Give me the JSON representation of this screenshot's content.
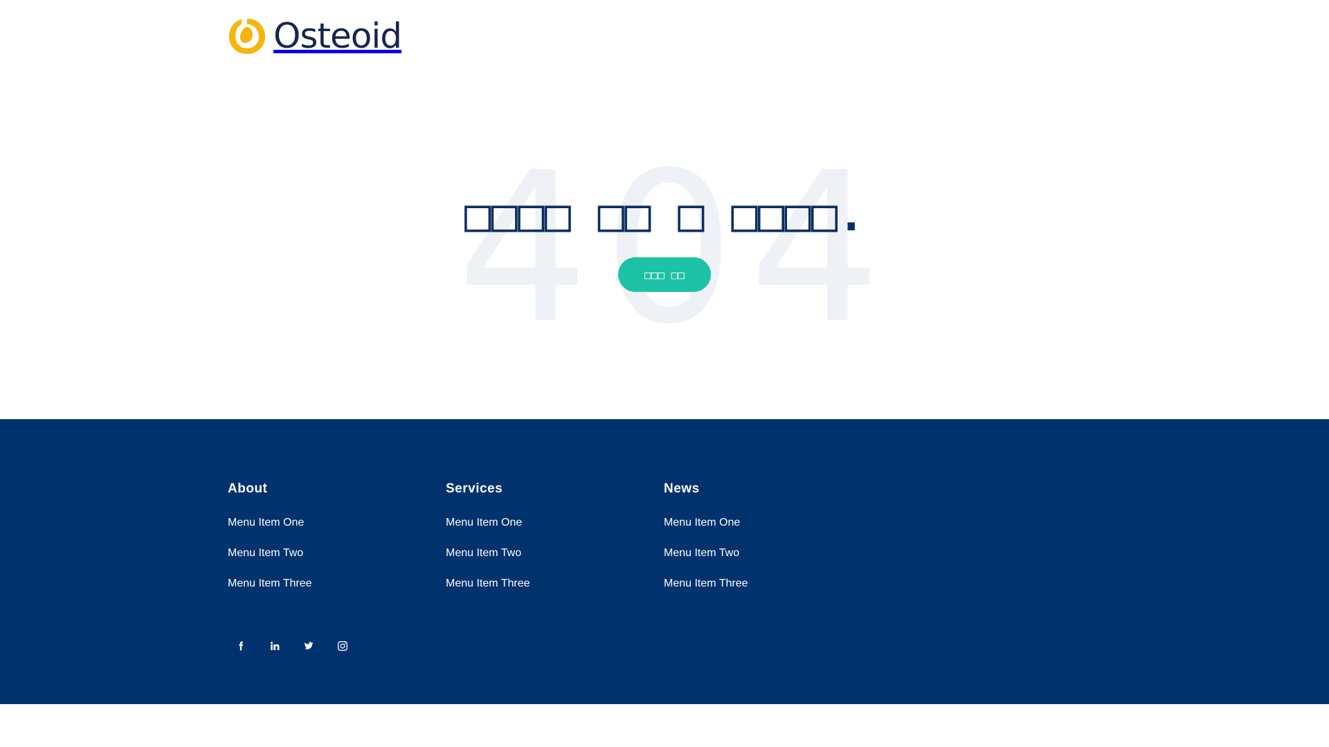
{
  "brand": {
    "name": "Osteoid",
    "colors": {
      "navy": "#00326e",
      "text_navy": "#16274b",
      "accent_teal": "#1cc2a3",
      "logo_yellow": "#f6b40e"
    }
  },
  "hero": {
    "background_code": "404",
    "headline": "□□□□ □□ □ □□□□.",
    "button_label": "□□□ □□"
  },
  "footer": {
    "columns": [
      {
        "title": "About",
        "items": [
          "Menu Item One",
          "Menu Item Two",
          "Menu Item Three"
        ]
      },
      {
        "title": "Services",
        "items": [
          "Menu Item One",
          "Menu Item Two",
          "Menu Item Three"
        ]
      },
      {
        "title": "News",
        "items": [
          "Menu Item One",
          "Menu Item Two",
          "Menu Item Three"
        ]
      }
    ],
    "social": [
      "facebook-icon",
      "linkedin-icon",
      "twitter-icon",
      "instagram-icon"
    ]
  }
}
